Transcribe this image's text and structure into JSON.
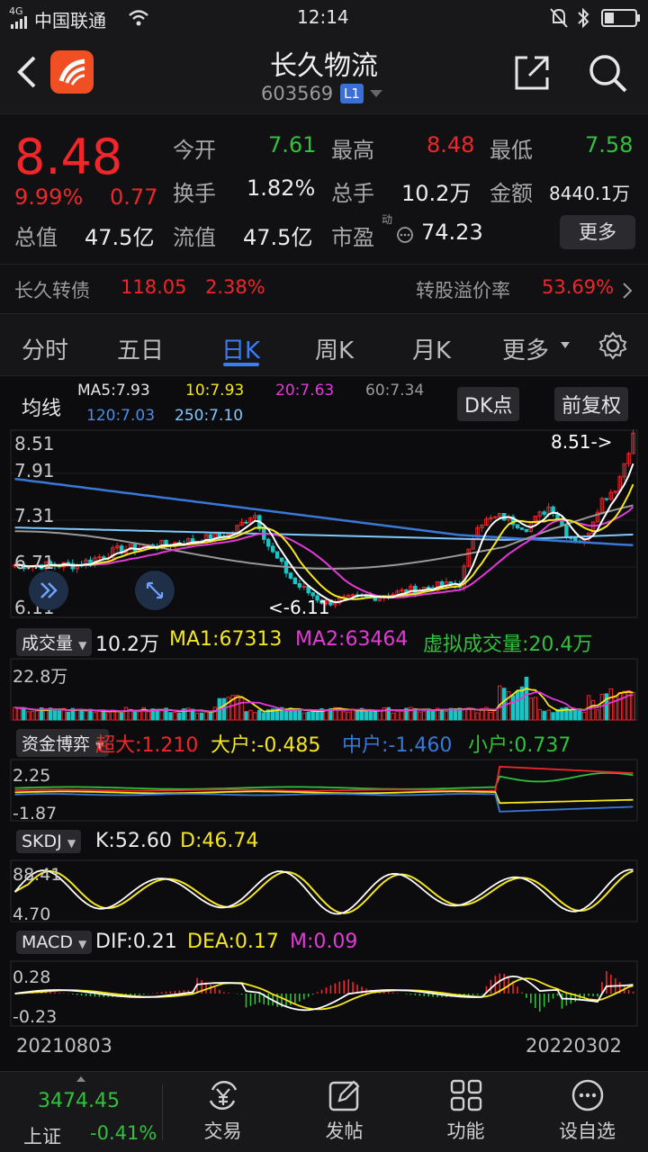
{
  "status_bar": {
    "signal": "4G",
    "carrier": "中国联通",
    "time": "12:14"
  },
  "header": {
    "title": "长久物流",
    "code": "603569",
    "level": "L1"
  },
  "quote": {
    "price": "8.48",
    "change_pct": "9.99%",
    "change": "0.77",
    "open_label": "今开",
    "open": "7.61",
    "high_label": "最高",
    "high": "8.48",
    "low_label": "最低",
    "low": "7.58",
    "turnover_label": "换手",
    "turnover": "1.82%",
    "volume_label": "总手",
    "volume": "10.2万",
    "amount_label": "金额",
    "amount": "8440.1万",
    "mktcap_label": "总值",
    "mktcap": "47.5亿",
    "float_label": "流值",
    "float": "47.5亿",
    "pe_label": "市盈",
    "pe_sup": "动",
    "pe": "74.23",
    "more_btn": "更多",
    "bond_label": "长久转债",
    "bond_price": "118.05",
    "bond_pct": "2.38%",
    "premium_label": "转股溢价率",
    "premium": "53.69%"
  },
  "tabs": {
    "items": [
      "分时",
      "五日",
      "日K",
      "周K",
      "月K",
      "更多"
    ],
    "active": "日K"
  },
  "kline": {
    "ma_title": "均线",
    "ma5": "MA5:7.93",
    "ma10": "10:7.93",
    "ma20": "20:7.63",
    "ma60": "60:7.34",
    "ma120": "120:7.03",
    "ma250": "250:7.10",
    "dk_btn": "DK点",
    "adjust_btn": "前复权",
    "y_labels": [
      "8.51",
      "7.91",
      "7.31",
      "6.71",
      "6.11"
    ],
    "high_mark": "8.51->",
    "low_mark": "<-6.11"
  },
  "volume": {
    "btn": "成交量",
    "value": "10.2万",
    "ma1": "MA1:67313",
    "ma2": "MA2:63464",
    "virtual": "虚拟成交量:20.4万",
    "y_label": "22.8万"
  },
  "capital": {
    "btn": "资金博弈",
    "super": "超大:1.210",
    "large": "大户:-0.485",
    "mid": "中户:-1.460",
    "small": "小户:0.737",
    "y_top": "2.25",
    "y_bottom": "-1.87"
  },
  "skdj": {
    "btn": "SKDJ",
    "k": "K:52.60",
    "d": "D:46.74",
    "y_top": "88.41",
    "y_bottom": "4.70"
  },
  "macd": {
    "btn": "MACD",
    "dif": "DIF:0.21",
    "dea": "DEA:0.17",
    "m": "M:0.09",
    "y_top": "0.28",
    "y_bottom": "-0.23"
  },
  "dates": {
    "start": "20210803",
    "end": "20220302"
  },
  "bottom_nav": {
    "index_value": "3474.45",
    "index_name": "上证",
    "index_pct": "-0.41%",
    "items": [
      "交易",
      "发帖",
      "功能",
      "设自选"
    ]
  },
  "colors": {
    "up": "#f0262a",
    "down": "#2fc23a",
    "ma5": "#ffffff",
    "ma10": "#f5e61e",
    "ma20": "#e23ad8",
    "accent": "#3b7df6"
  }
}
